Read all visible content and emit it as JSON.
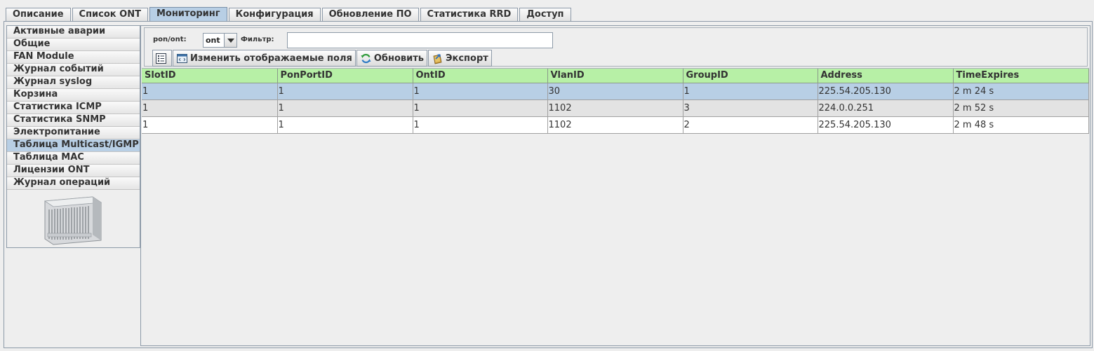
{
  "top_tabs": [
    {
      "label": "Описание",
      "active": false
    },
    {
      "label": "Список ONT",
      "active": false
    },
    {
      "label": "Мониторинг",
      "active": true
    },
    {
      "label": "Конфигурация",
      "active": false
    },
    {
      "label": "Обновление ПО",
      "active": false
    },
    {
      "label": "Статистика RRD",
      "active": false
    },
    {
      "label": "Доступ",
      "active": false
    }
  ],
  "side_menu": [
    {
      "label": "Активные аварии",
      "active": false
    },
    {
      "label": "Общие",
      "active": false
    },
    {
      "label": "FAN Module",
      "active": false
    },
    {
      "label": "Журнал событий",
      "active": false
    },
    {
      "label": "Журнал syslog",
      "active": false
    },
    {
      "label": "Корзина",
      "active": false
    },
    {
      "label": "Статистика ICMP",
      "active": false
    },
    {
      "label": "Статистика SNMP",
      "active": false
    },
    {
      "label": "Электропитание",
      "active": false
    },
    {
      "label": "Таблица Multicast/IGMP",
      "active": true
    },
    {
      "label": "Таблица MAC",
      "active": false
    },
    {
      "label": "Лицензии ONT",
      "active": false
    },
    {
      "label": "Журнал операций",
      "active": false
    }
  ],
  "filter": {
    "pon_label": "pon/ont:",
    "pon_value": "ont",
    "filter_label": "Фильтр:",
    "filter_value": ""
  },
  "toolbar": {
    "fields_label": "Изменить отображаемые поля",
    "refresh_label": "Обновить",
    "export_label": "Экспорт"
  },
  "table": {
    "columns": [
      "SlotID",
      "PonPortID",
      "OntID",
      "VlanID",
      "GroupID",
      "Address",
      "TimeExpires"
    ],
    "rows": [
      [
        "1",
        "1",
        "1",
        "30",
        "1",
        "225.54.205.130",
        "2 m 24 s"
      ],
      [
        "1",
        "1",
        "1",
        "1102",
        "3",
        "224.0.0.251",
        "2 m 52 s"
      ],
      [
        "1",
        "1",
        "1",
        "1102",
        "2",
        "225.54.205.130",
        "2 m 48 s"
      ]
    ],
    "selected_row": 0
  },
  "colors": {
    "accent": "#b8cfe5",
    "header_green": "#b7f0a6"
  }
}
